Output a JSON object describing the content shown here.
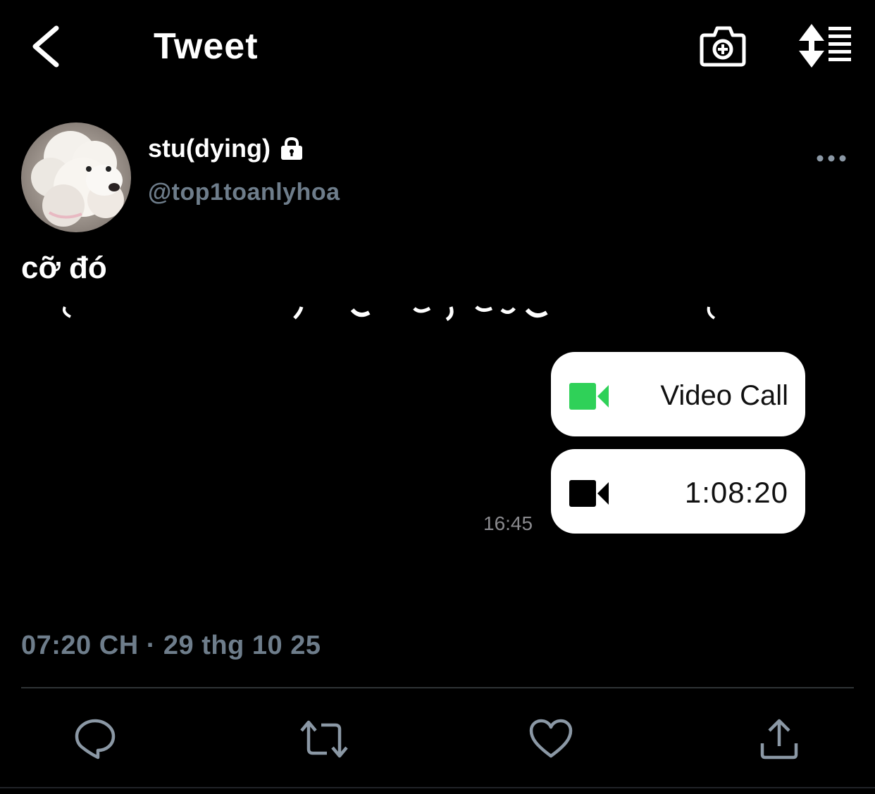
{
  "header": {
    "title": "Tweet",
    "back_icon": "chevron-left-icon",
    "camera_icon": "camera-add-icon",
    "sort_icon": "sort-list-icon"
  },
  "author": {
    "display_name": "stu(dying)",
    "username": "@top1toanlyhoa",
    "protected_icon": "lock-icon",
    "avatar_subject": "white poodle"
  },
  "tweet": {
    "text": "cỡ đó",
    "timestamp": "07:20 CH · 29 thg 10 25"
  },
  "media": {
    "call_bubble": {
      "label": "Video Call",
      "icon": "video-camera-icon",
      "icon_color": "#2fd158"
    },
    "duration_bubble": {
      "duration": "1:08:20",
      "icon": "video-camera-icon",
      "icon_color": "#000000"
    },
    "message_time": "16:45"
  },
  "actions": {
    "reply_icon": "reply-icon",
    "retweet_icon": "retweet-icon",
    "like_icon": "heart-icon",
    "share_icon": "share-icon"
  },
  "colors": {
    "background": "#000000",
    "muted_text": "#6e7d8b",
    "accent_green": "#2fd158"
  }
}
